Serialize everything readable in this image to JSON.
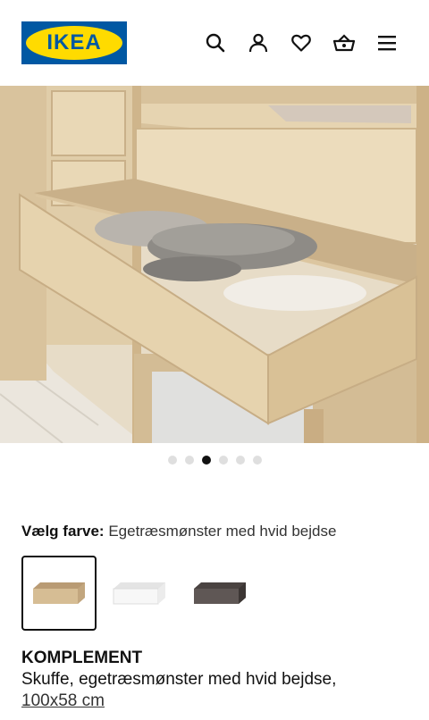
{
  "header": {
    "logo_text": "IKEA",
    "icons": [
      "search-icon",
      "account-icon",
      "heart-icon",
      "basket-icon",
      "menu-icon"
    ]
  },
  "gallery": {
    "image": "drawer-photo",
    "dot_count": 6,
    "active_index": 2
  },
  "color_picker": {
    "label": "Vælg farve:",
    "selected_value": "Egetræsmønster med hvid bejdse",
    "swatches": [
      "oak-effect-white-stained",
      "white",
      "dark-brown"
    ],
    "selected_index": 0
  },
  "product": {
    "name": "KOMPLEMENT",
    "description": "Skuffe, egetræsmønster med hvid bejdse,",
    "dimensions": "100x58 cm"
  },
  "colors": {
    "brand_blue": "#0058a3",
    "brand_yellow": "#ffdb00"
  }
}
